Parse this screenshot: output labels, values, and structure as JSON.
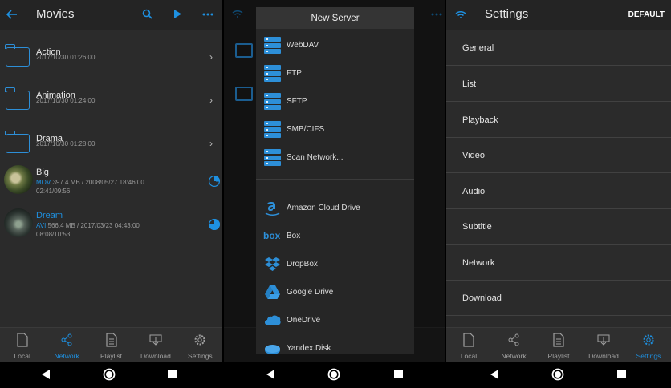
{
  "screen1": {
    "title": "Movies",
    "items": [
      {
        "name": "Action",
        "date": "2017/10/30 01:26:00",
        "type": "folder"
      },
      {
        "name": "Animation",
        "date": "2017/10/30 01:24:00",
        "type": "folder"
      },
      {
        "name": "Drama",
        "date": "2017/10/30 01:28:00",
        "type": "folder"
      },
      {
        "name": "Big",
        "format": "MOV",
        "info": " 397.4 MB / 2008/05/27 18:46:00",
        "progress": "02:41/09:56",
        "type": "video",
        "progress_fraction": 0.27
      },
      {
        "name": "Dream",
        "format": "AVI",
        "info": " 566.4 MB / 2017/03/23 04:43:00",
        "progress": "08:08/10:53",
        "type": "video",
        "progress_fraction": 0.75
      }
    ]
  },
  "screen2": {
    "dialog_title": "New Server",
    "servers": [
      "WebDAV",
      "FTP",
      "SFTP",
      "SMB/CIFS",
      "Scan Network..."
    ],
    "clouds": [
      "Amazon Cloud Drive",
      "Box",
      "DropBox",
      "Google Drive",
      "OneDrive",
      "Yandex.Disk"
    ]
  },
  "screen3": {
    "title": "Settings",
    "default_label": "DEFAULT",
    "items": [
      "General",
      "List",
      "Playback",
      "Video",
      "Audio",
      "Subtitle",
      "Network",
      "Download"
    ]
  },
  "nav": [
    "Local",
    "Network",
    "Playlist",
    "Download",
    "Settings"
  ],
  "colors": {
    "accent": "#1e90e0",
    "panel": "#2b2b2b",
    "appbar": "#242424"
  }
}
